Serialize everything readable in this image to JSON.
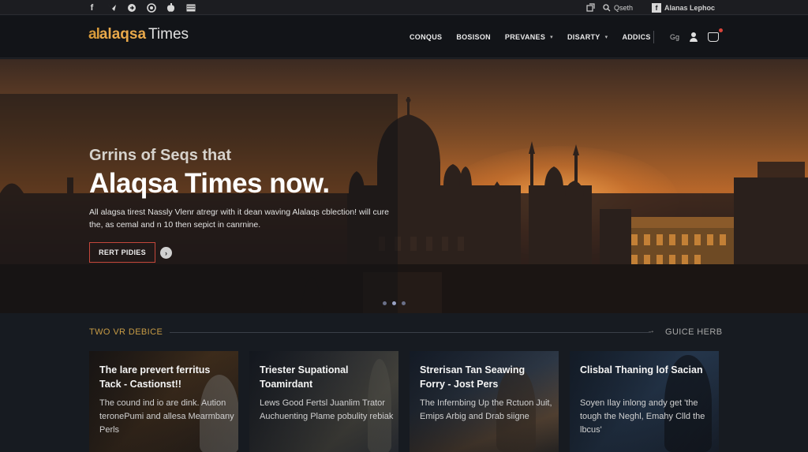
{
  "topbar": {
    "social_icons": [
      "facebook-icon",
      "twitter-icon",
      "share-icon",
      "instagram-icon",
      "apple-icon",
      "mail-icon"
    ],
    "search_label": "Qseth",
    "account_label": "Alanas Lephoc"
  },
  "header": {
    "logo_mark": "al",
    "logo_brand": "alaqsa",
    "logo_suffix": "Times",
    "nav": [
      {
        "label": "CONQUS",
        "dropdown": false
      },
      {
        "label": "BOSISON",
        "dropdown": false
      },
      {
        "label": "PREVANES",
        "dropdown": true
      },
      {
        "label": "DISARTY",
        "dropdown": true
      },
      {
        "label": "ADDICS",
        "dropdown": false
      }
    ],
    "lang_label": "Gg"
  },
  "hero": {
    "kicker": "Grrins of Seqs that",
    "headline": "Alaqsa Times now.",
    "description": "All alagsa tirest Nassly Vlenr atregr with it dean waving Alalaqs cblection! will cure the, as cemal and n 10 then sepict in canrnine.",
    "cta_label": "RERT PIDIES",
    "arrow_glyph": "›",
    "slides": 3,
    "active_slide": 2
  },
  "section": {
    "title": "TWO VR DEBICE",
    "right_label": "GUICE HERB",
    "arrow_glyph": "→"
  },
  "cards": [
    {
      "title": "The lare prevert ferritus Tack - Castionst!!",
      "body": "The cound ind io are dink. Aution teronePumi and allesa Mearmbany Perls"
    },
    {
      "title": "Triester Supational Toamirdant",
      "body": "Lews Good Fertsl Juanlim Trator Auchuenting Plame pobulity rebiak"
    },
    {
      "title": "Strerisan Tan Seawing Forry - Jost Pers",
      "body": "The Infernbing Up the Rctuon Juit, Emips Arbig and Drab siigne"
    },
    {
      "title": "Clisbal Thaning lof Sacian",
      "body": "Soyen Ilay inlong andy get 'the tough the Neghl, Emahy Clld the lbcus'"
    }
  ],
  "colors": {
    "accent": "#c79b45",
    "cta_border": "#c4473b",
    "header_bg": "#121418",
    "section_bg": "#171b21"
  }
}
